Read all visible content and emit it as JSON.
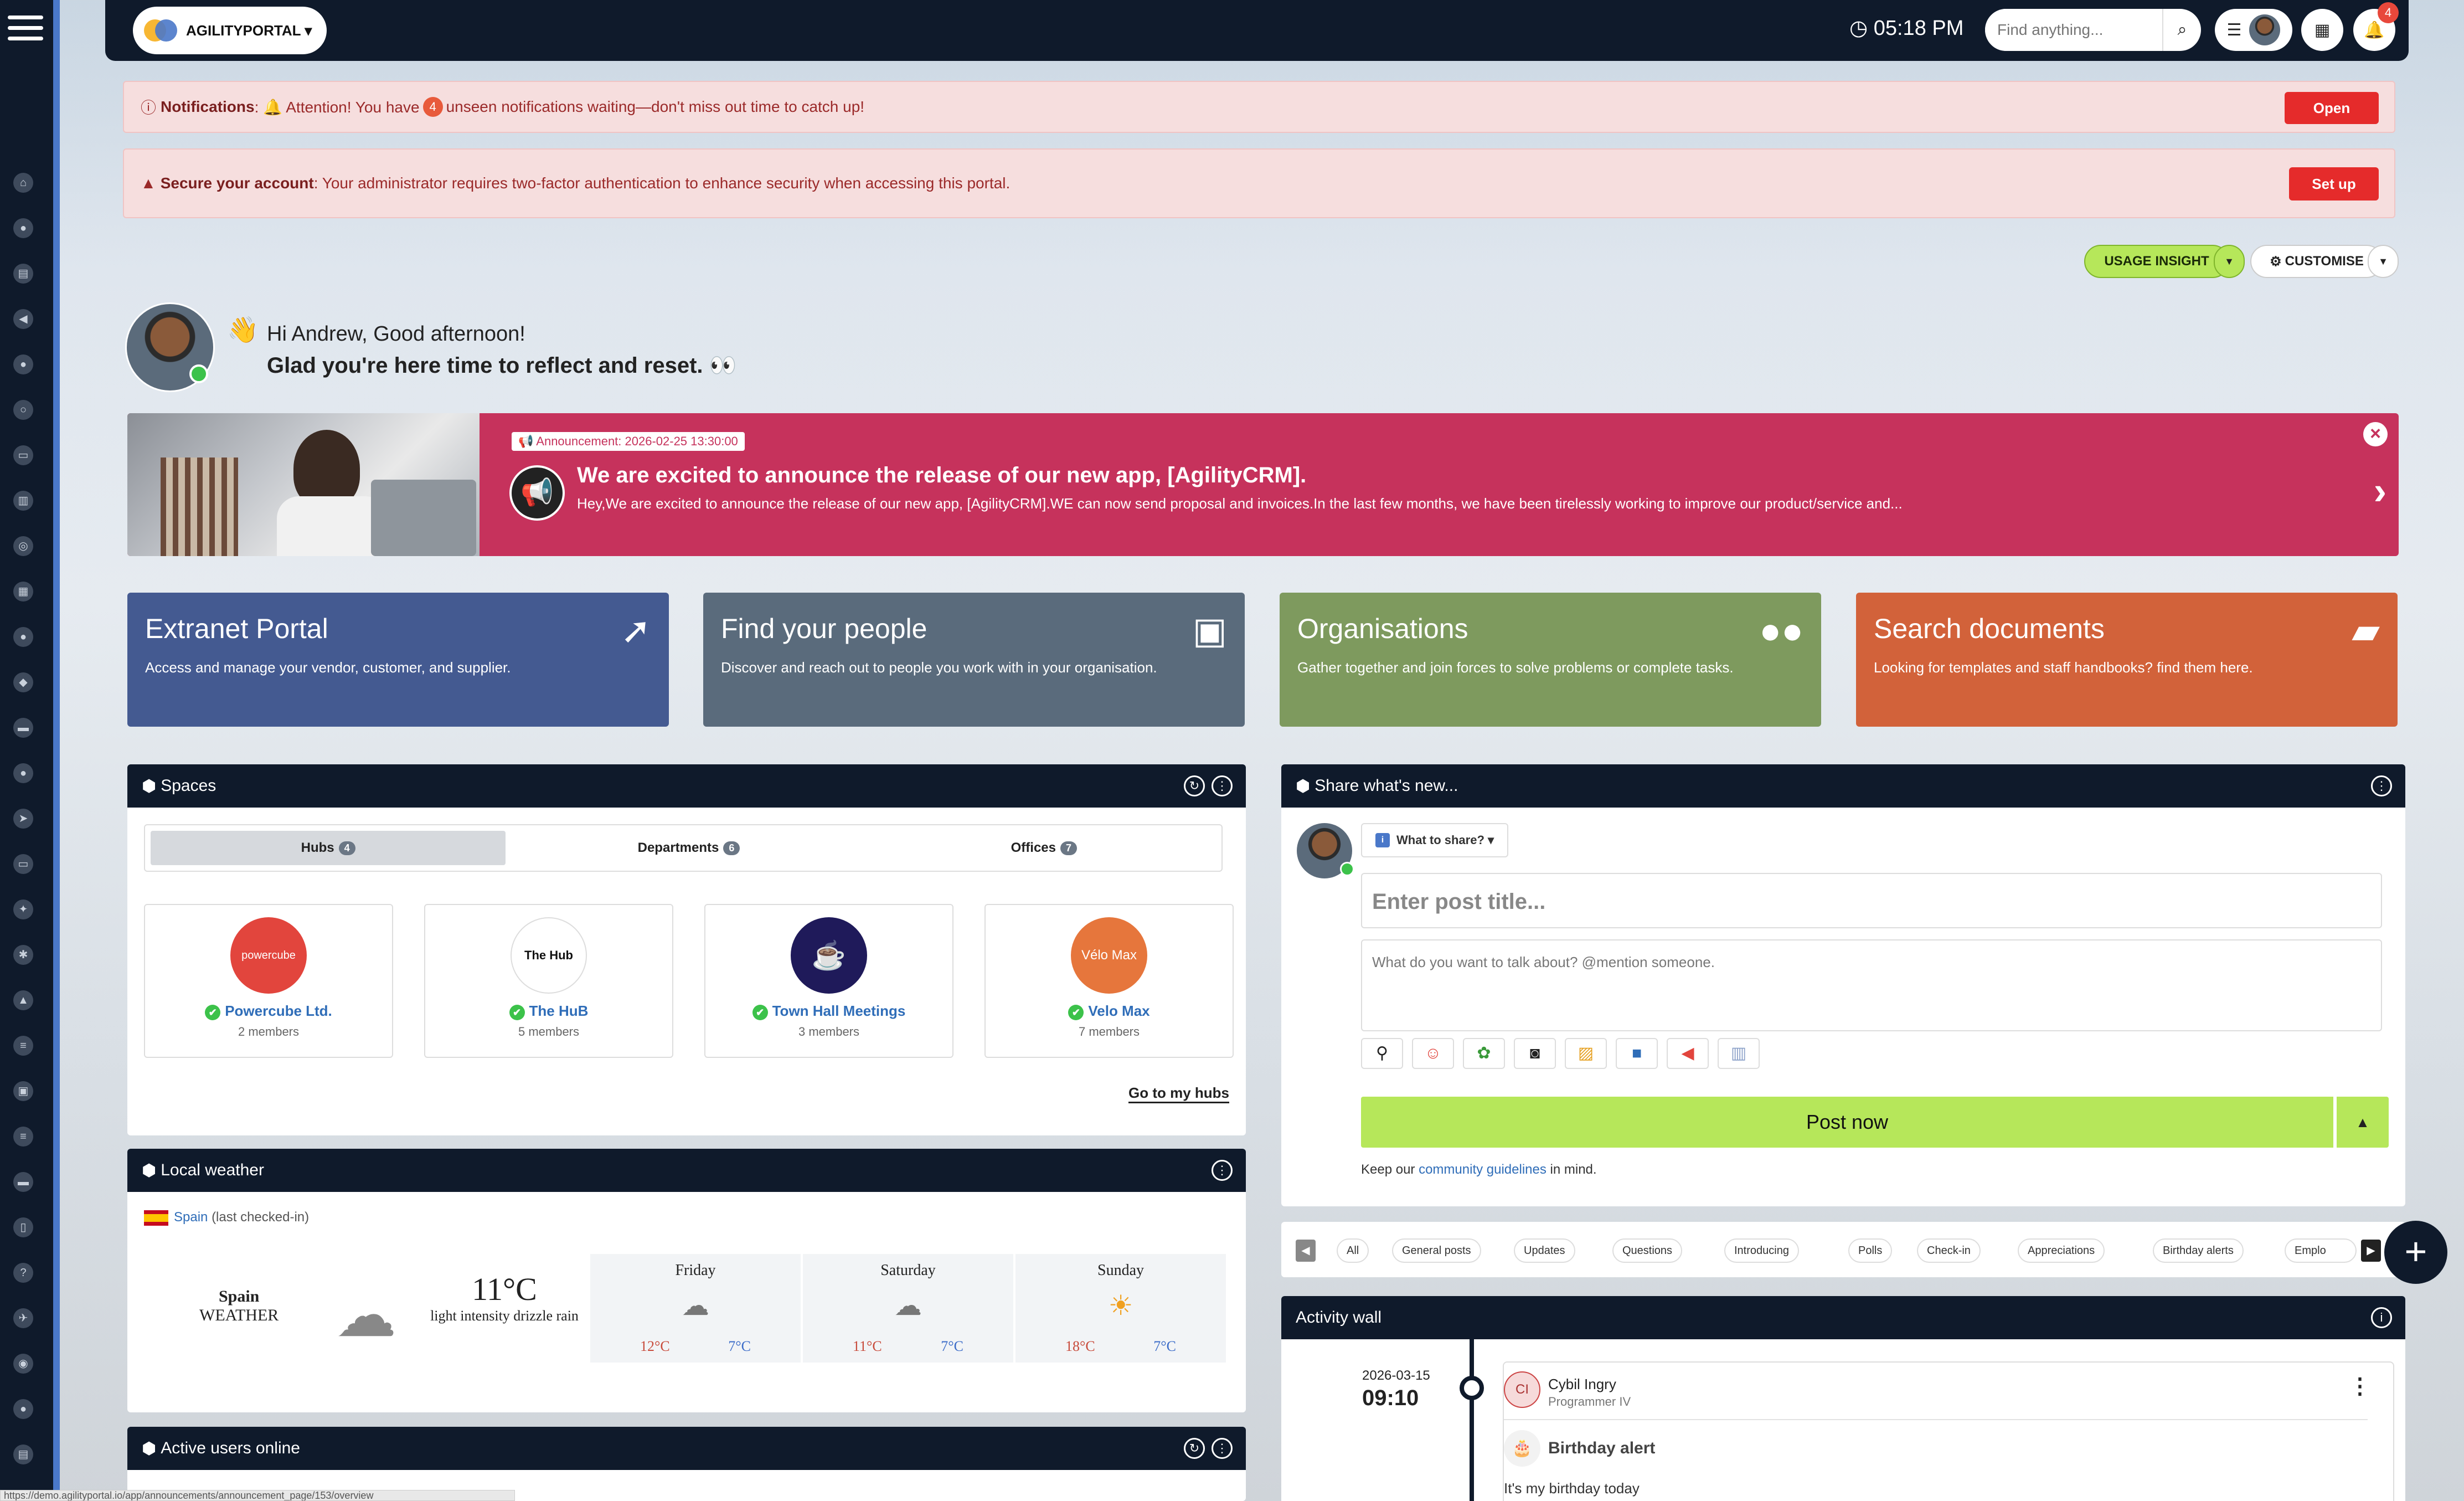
{
  "topbar": {
    "brand": "AGILITYPORTAL ▾",
    "clock": "05:18 PM",
    "search_placeholder": "Find anything...",
    "notification_count": "4"
  },
  "alerts": {
    "notifications": {
      "label": "Notifications",
      "text_before": ": 🔔 Attention! You have ",
      "count": "4",
      "text_after": " unseen notifications waiting—don't miss out time to catch up!",
      "button": "Open"
    },
    "security": {
      "label": "Secure your account",
      "text": ": Your administrator requires two-factor authentication to enhance security when accessing this portal.",
      "button": "Set up"
    }
  },
  "actions": {
    "usage_insight": "USAGE INSIGHT",
    "customise": "CUSTOMISE"
  },
  "greeting": {
    "line1": "Hi Andrew, Good afternoon!",
    "line2": "Glad you're here time to reflect and reset. 👀",
    "wave": "👋"
  },
  "announcement": {
    "tag": "📢 Announcement: 2026-02-25 13:30:00",
    "title": "We are excited to announce the release of our new app, [AgilityCRM].",
    "text": "Hey,We are excited to announce the release of our new app, [AgilityCRM].WE can now send proposal and invoices.In the last few months, we have been tirelessly working to improve our product/service and..."
  },
  "tiles": [
    {
      "title": "Extranet Portal",
      "desc": "Access and manage your vendor, customer, and supplier.",
      "color": "#445a91",
      "icon": "🚀"
    },
    {
      "title": "Find your people",
      "desc": "Discover and reach out to people you work with in your organisation.",
      "color": "#5a6b7c",
      "icon": "📇"
    },
    {
      "title": "Organisations",
      "desc": "Gather together and join forces to solve problems or complete tasks.",
      "color": "#7e9a5e",
      "icon": "👥"
    },
    {
      "title": "Search documents",
      "desc": "Looking for templates and staff handbooks? find them here.",
      "color": "#d2623a",
      "icon": "📁"
    }
  ],
  "spaces": {
    "title": "Spaces",
    "tabs": [
      {
        "label": "Hubs",
        "count": "4"
      },
      {
        "label": "Departments",
        "count": "6"
      },
      {
        "label": "Offices",
        "count": "7"
      }
    ],
    "hubs": [
      {
        "name": "Powercube Ltd.",
        "members": "2 members",
        "color": "#e2453d",
        "logo_text": "powercube"
      },
      {
        "name": "The HuB",
        "members": "5 members",
        "color": "#ffffff",
        "logo_text": "The Hub"
      },
      {
        "name": "Town Hall Meetings",
        "members": "3 members",
        "color": "#1f1a5a",
        "logo_text": "☕"
      },
      {
        "name": "Velo Max",
        "members": "7 members",
        "color": "#e6763c",
        "logo_text": "Vélo Max"
      }
    ],
    "go_link": "Go to my hubs"
  },
  "weather": {
    "title": "Local weather",
    "country": "Spain",
    "checked": "(last checked-in)",
    "city": "Spain",
    "label": "WEATHER",
    "temp": "11°C",
    "desc": "light intensity drizzle rain",
    "forecast": [
      {
        "day": "Friday",
        "hi": "12°C",
        "lo": "7°C",
        "icon": "☁"
      },
      {
        "day": "Saturday",
        "hi": "11°C",
        "lo": "7°C",
        "icon": "☁"
      },
      {
        "day": "Sunday",
        "hi": "18°C",
        "lo": "7°C",
        "icon": "☀"
      }
    ]
  },
  "active_users": {
    "title": "Active users online"
  },
  "share": {
    "title": "Share what's new...",
    "what_to_share": "What to share? ▾",
    "title_placeholder": "Enter post title...",
    "body_placeholder": "What do you want to talk about? @mention someone.",
    "post_button": "Post now",
    "guideline_before": "Keep our ",
    "guideline_link": "community guidelines",
    "guideline_after": " in mind."
  },
  "filters": [
    "All",
    "General posts",
    "Updates",
    "Questions",
    "Introducing",
    "Polls",
    "Check-in",
    "Appreciations",
    "Birthday alerts",
    "Emplo"
  ],
  "activity": {
    "title": "Activity wall",
    "date": "2026-03-15",
    "time": "09:10",
    "user_initials": "CI",
    "user_name": "Cybil Ingry",
    "user_role": "Programmer IV",
    "post_type": "Birthday alert",
    "post_text": "It's my birthday today"
  },
  "status_url": "https://demo.agilityportal.io/app/announcements/announcement_page/153/overview"
}
